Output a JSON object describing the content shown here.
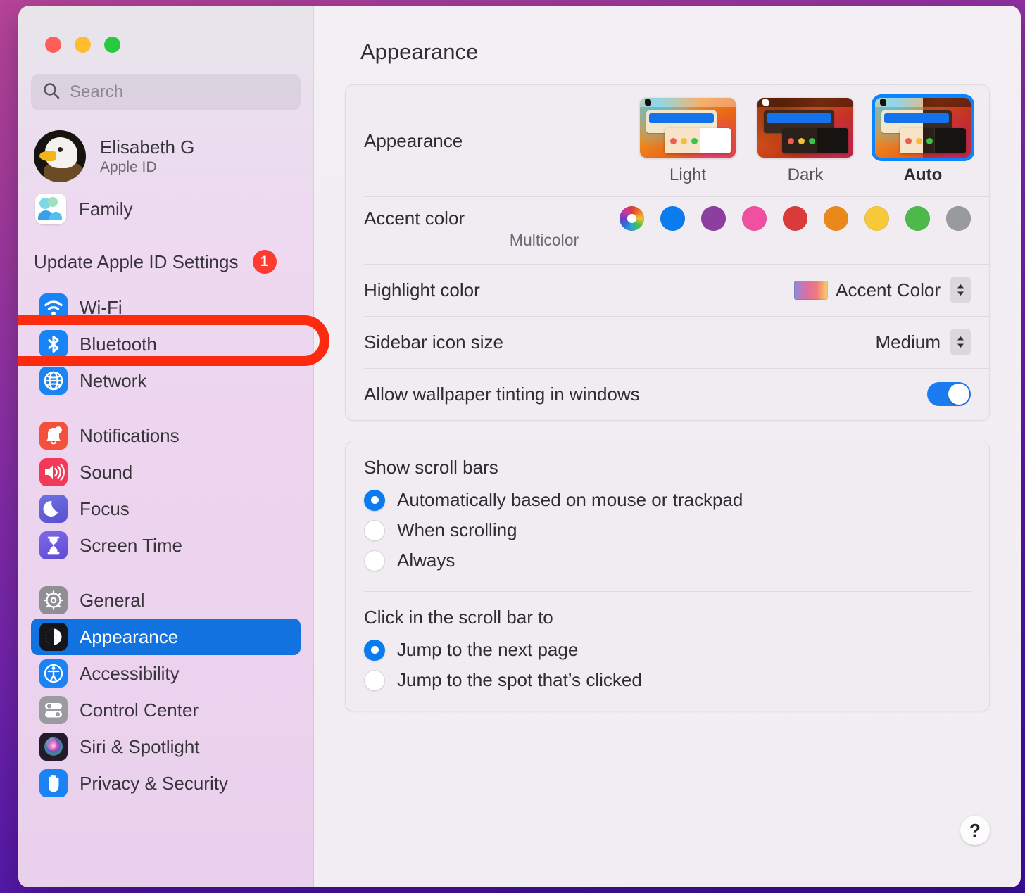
{
  "window": {
    "traffic_lights": [
      "close",
      "minimize",
      "zoom"
    ]
  },
  "search": {
    "placeholder": "Search",
    "value": ""
  },
  "account": {
    "name": "Elisabeth G",
    "subtitle": "Apple ID",
    "family_label": "Family",
    "update_label": "Update Apple ID Settings",
    "update_badge": "1"
  },
  "sidebar": {
    "groups": [
      {
        "items": [
          {
            "label": "Wi-Fi",
            "icon": "wifi-icon",
            "color": "#1a84f5",
            "selected": false,
            "annotated": true
          },
          {
            "label": "Bluetooth",
            "icon": "bluetooth-icon",
            "color": "#1a84f5",
            "selected": false
          },
          {
            "label": "Network",
            "icon": "network-globe-icon",
            "color": "#1a84f5",
            "selected": false
          }
        ]
      },
      {
        "items": [
          {
            "label": "Notifications",
            "icon": "bell-icon",
            "color": "#f4503c",
            "selected": false
          },
          {
            "label": "Sound",
            "icon": "speaker-icon",
            "color": "#f2395a",
            "selected": false
          },
          {
            "label": "Focus",
            "icon": "moon-icon",
            "color": "#5d5fd6",
            "selected": false
          },
          {
            "label": "Screen Time",
            "icon": "hourglass-icon",
            "color": "#6a5de0",
            "selected": false
          }
        ]
      },
      {
        "items": [
          {
            "label": "General",
            "icon": "gear-icon",
            "color": "#8e8e93",
            "selected": false
          },
          {
            "label": "Appearance",
            "icon": "appearance-contrast-icon",
            "color": "#1c1c1e",
            "selected": true
          },
          {
            "label": "Accessibility",
            "icon": "accessibility-icon",
            "color": "#1a84f5",
            "selected": false
          },
          {
            "label": "Control Center",
            "icon": "control-center-icon",
            "color": "#9a9a9f",
            "selected": false
          },
          {
            "label": "Siri & Spotlight",
            "icon": "siri-icon",
            "color": "#2a2030",
            "selected": false
          },
          {
            "label": "Privacy & Security",
            "icon": "hand-privacy-icon",
            "color": "#1a84f5",
            "selected": false
          }
        ]
      }
    ]
  },
  "main": {
    "page_title": "Appearance",
    "appearance": {
      "label": "Appearance",
      "options": [
        {
          "caption": "Light",
          "selected": false
        },
        {
          "caption": "Dark",
          "selected": false
        },
        {
          "caption": "Auto",
          "selected": true
        }
      ]
    },
    "accent": {
      "label": "Accent color",
      "sublabel": "Multicolor",
      "swatches": [
        {
          "name": "multicolor",
          "color": "multicolor",
          "selected": true
        },
        {
          "name": "blue",
          "color": "#0a7cf0"
        },
        {
          "name": "purple",
          "color": "#8d3fa0"
        },
        {
          "name": "pink",
          "color": "#f0509f"
        },
        {
          "name": "red",
          "color": "#d93a3a"
        },
        {
          "name": "orange",
          "color": "#e8891a"
        },
        {
          "name": "yellow",
          "color": "#f7c938"
        },
        {
          "name": "green",
          "color": "#4fb84a"
        },
        {
          "name": "graphite",
          "color": "#989a9c"
        }
      ]
    },
    "highlight": {
      "label": "Highlight color",
      "value": "Accent Color"
    },
    "sidebar_icon_size": {
      "label": "Sidebar icon size",
      "value": "Medium"
    },
    "wallpaper_tinting": {
      "label": "Allow wallpaper tinting in windows",
      "enabled": true
    },
    "scroll_bars": {
      "heading": "Show scroll bars",
      "options": [
        {
          "label": "Automatically based on mouse or trackpad",
          "selected": true
        },
        {
          "label": "When scrolling",
          "selected": false
        },
        {
          "label": "Always",
          "selected": false
        }
      ]
    },
    "scroll_click": {
      "heading": "Click in the scroll bar to",
      "options": [
        {
          "label": "Jump to the next page",
          "selected": true
        },
        {
          "label": "Jump to the spot that’s clicked",
          "selected": false
        }
      ]
    },
    "help_label": "?"
  },
  "colors": {
    "accent_blue": "#1272e0",
    "annotation_red": "#fc2b10",
    "badge_red": "#ff3b30"
  }
}
